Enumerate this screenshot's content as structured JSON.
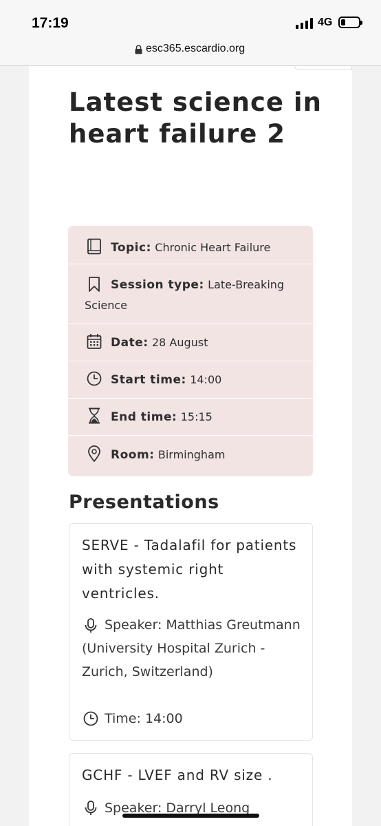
{
  "status_bar": {
    "time": "17:19",
    "network": "4G",
    "battery_level": 0.25
  },
  "browser": {
    "url": "esc365.escardio.org"
  },
  "session": {
    "title": "Latest science in heart failure 2",
    "details": [
      {
        "icon": "book-icon",
        "label": "Topic:",
        "value": "Chronic Heart Failure"
      },
      {
        "icon": "bookmark-icon",
        "label": "Session type:",
        "value": "Late-Breaking Science"
      },
      {
        "icon": "calendar-icon",
        "label": "Date:",
        "value": "28 August"
      },
      {
        "icon": "clock-icon",
        "label": "Start time:",
        "value": "14:00"
      },
      {
        "icon": "hourglass-icon",
        "label": "End time:",
        "value": "15:15"
      },
      {
        "icon": "location-pin-icon",
        "label": "Room:",
        "value": "Birmingham"
      }
    ]
  },
  "presentations": {
    "heading": "Presentations",
    "items": [
      {
        "title": "SERVE - Tadalafil for patients with systemic right ventricles.",
        "speaker": "Speaker: Matthias Greutmann (University Hospital Zurich - Zurich, Switzerland)",
        "time": "Time: 14:00"
      },
      {
        "title": "GCHF - LVEF and RV size  .",
        "speaker": "Speaker: Darryl Leong"
      }
    ]
  }
}
